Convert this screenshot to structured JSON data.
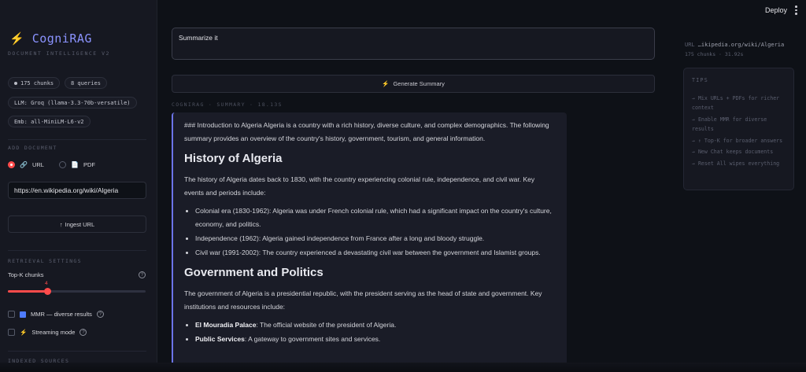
{
  "header": {
    "deploy_label": "Deploy"
  },
  "sidebar": {
    "brand": "CogniRAG",
    "tagline": "DOCUMENT INTELLIGENCE V2",
    "chips": {
      "chunks": "175 chunks",
      "queries": "8 queries",
      "llm": "LLM: Groq (llama-3.3-70b-versatile)",
      "emb": "Emb: all-MiniLM-L6-v2"
    },
    "add_document_label": "ADD DOCUMENT",
    "source_options": [
      "URL",
      "PDF"
    ],
    "selected_source": "URL",
    "url_value": "https://en.wikipedia.org/wiki/Algeria",
    "ingest_label": "Ingest URL",
    "retrieval_label": "RETRIEVAL SETTINGS",
    "topk_label": "Top-K chunks",
    "topk_value": "4",
    "topk_fraction": 0.27,
    "mmr_label": "MMR — diverse results",
    "streaming_label": "Streaming mode",
    "indexed_label": "INDEXED SOURCES"
  },
  "main": {
    "query_value": "Summarize it",
    "generate_label": "Generate Summary",
    "meta_line": "COGNIRAG · SUMMARY · 18.13S",
    "answer": {
      "intro": "### Introduction to Algeria Algeria is a country with a rich history, diverse culture, and complex demographics. The following summary provides an overview of the country's history, government, tourism, and general information.",
      "h1": "History of Algeria",
      "p1": "The history of Algeria dates back to 1830, with the country experiencing colonial rule, independence, and civil war. Key events and periods include:",
      "list1": [
        "Colonial era (1830-1962): Algeria was under French colonial rule, which had a significant impact on the country's culture, economy, and politics.",
        "Independence (1962): Algeria gained independence from France after a long and bloody struggle.",
        "Civil war (1991-2002): The country experienced a devastating civil war between the government and Islamist groups."
      ],
      "h2": "Government and Politics",
      "p2": "The government of Algeria is a presidential republic, with the president serving as the head of state and government. Key institutions and resources include:",
      "list2": [
        {
          "bold": "El Mouradia Palace",
          "text": ": The official website of the president of Algeria."
        },
        {
          "bold": "Public Services",
          "text": ": A gateway to government sites and services."
        }
      ]
    }
  },
  "right_panel": {
    "url_key": "URL",
    "url_value": "…ikipedia.org/wiki/Algeria",
    "sub": "175 chunks · 31.92s",
    "tips_title": "TIPS",
    "tips": [
      "→ Mix URLs + PDFs for richer context",
      "→ Enable MMR for diverse results",
      "→ ↑ Top-K for broader answers",
      "→ New Chat keeps documents",
      "→ Reset All wipes everything"
    ]
  },
  "colors": {
    "accent": "#ff4b4b",
    "brand": "#8b93ff",
    "answer_border": "#6c74e8"
  }
}
